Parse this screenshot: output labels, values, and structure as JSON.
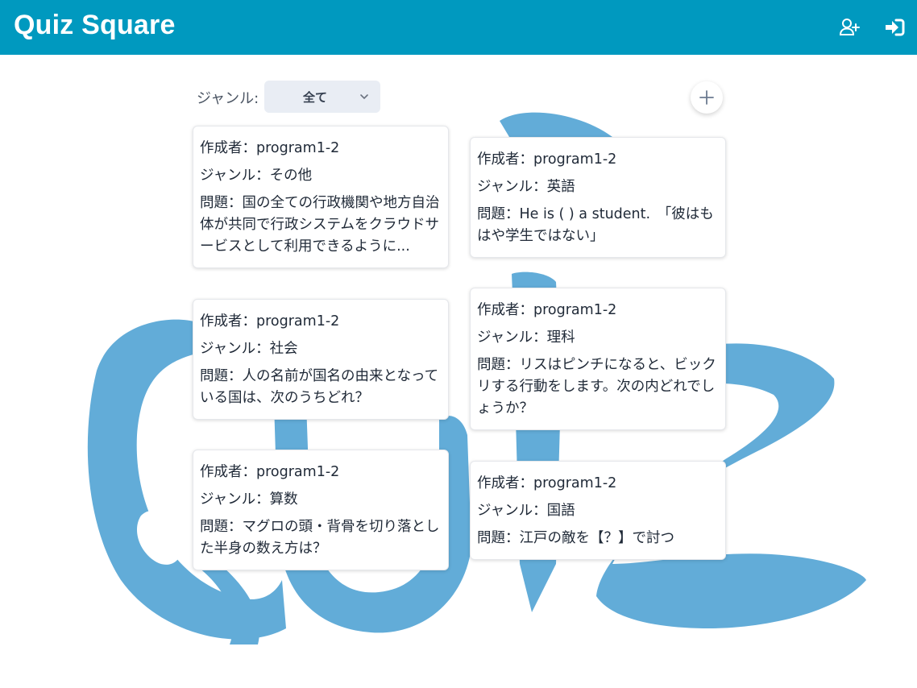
{
  "app": {
    "title": "Quiz Square",
    "header_icons": [
      "user-plus-icon",
      "sign-in-icon"
    ],
    "header_color": "#0099bf"
  },
  "filter": {
    "label": "ジャンル:",
    "selected": "全て"
  },
  "add_button": {
    "icon": "plus-icon"
  },
  "background": {
    "art": "quiz-brush-logo",
    "color": "#5aa8d6"
  },
  "quizzes": [
    {
      "author": "作成者：program1-2",
      "genre": "ジャンル：その他",
      "question": "問題：国の全ての行政機関や地方自治体が共同で行政システムをクラウドサービスとして利用できるように..."
    },
    {
      "author": "作成者：program1-2",
      "genre": "ジャンル：英語",
      "question": "問題：He is ( ) a student.　「彼はもはや学生ではない」"
    },
    {
      "author": "作成者：program1-2",
      "genre": "ジャンル：社会",
      "question": "問題：人の名前が国名の由来となっている国は、次のうちどれ？"
    },
    {
      "author": "作成者：program1-2",
      "genre": "ジャンル：理科",
      "question": "問題：リスはピンチになると、ビックリする行動をします。次の内どれでしょうか？"
    },
    {
      "author": "作成者：program1-2",
      "genre": "ジャンル：算数",
      "question": "問題：マグロの頭・背骨を切り落とした半身の数え方は？"
    },
    {
      "author": "作成者：program1-2",
      "genre": "ジャンル：国語",
      "question": "問題：江戸の敵を【？】で討つ"
    }
  ]
}
